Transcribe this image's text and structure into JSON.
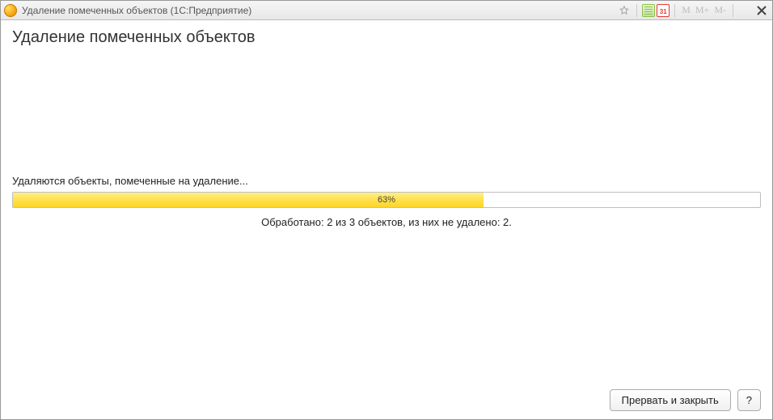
{
  "titlebar": {
    "app_icon_text": "1C",
    "title": "Удаление помеченных объектов  (1С:Предприятие)",
    "calendar_day": "31",
    "m_labels": [
      "M",
      "M+",
      "M-"
    ]
  },
  "main": {
    "heading": "Удаление помеченных объектов",
    "status": "Удаляются объекты, помеченные на удаление...",
    "progress": {
      "percent": 63,
      "label": "63%"
    },
    "processed": "Обработано: 2 из 3 объектов, из них не удалено: 2."
  },
  "footer": {
    "abort_close": "Прервать и закрыть",
    "help": "?"
  }
}
